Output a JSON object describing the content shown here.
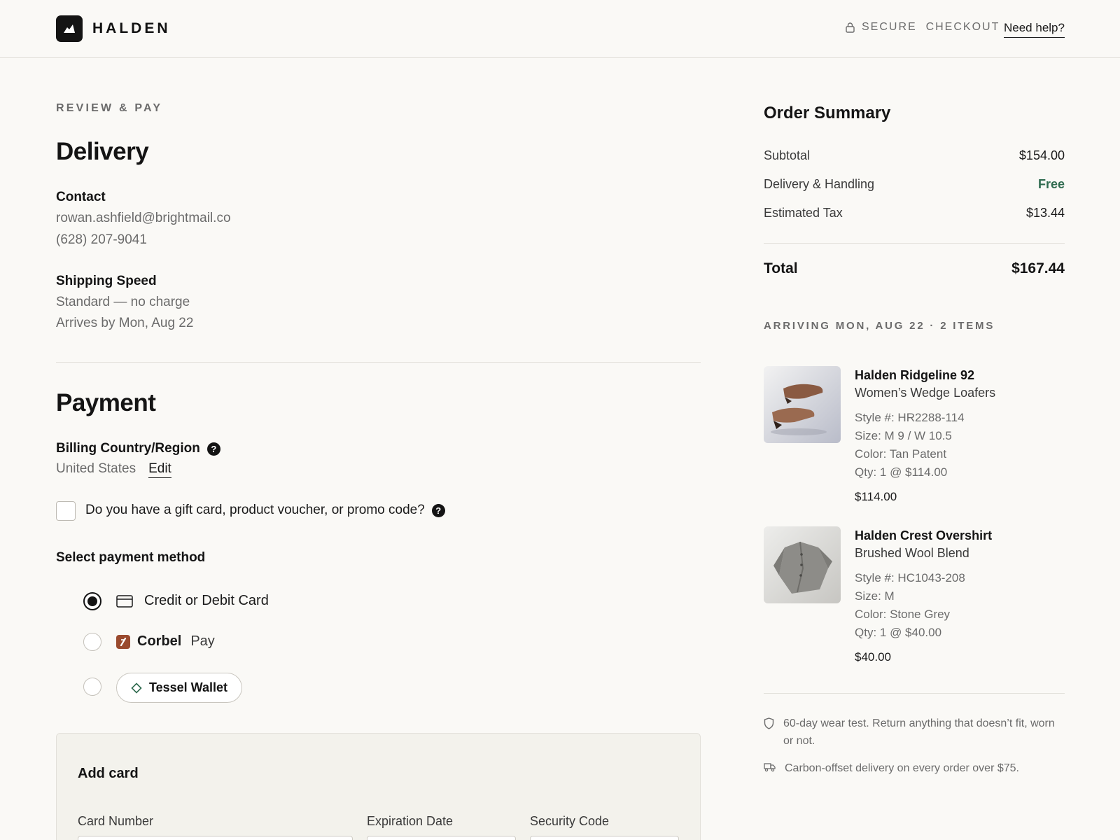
{
  "header": {
    "brand": "HALDEN",
    "secure_label": "SECURE  CHECKOUT",
    "help_link": "Need help?"
  },
  "eyebrow": "REVIEW & PAY",
  "delivery": {
    "heading": "Delivery",
    "contact_label": "Contact",
    "email": "rowan.ashfield@brightmail.co",
    "phone": "(628) 207-9041",
    "shipping_label": "Shipping Speed",
    "shipping_method": "Standard — no charge",
    "arrives": "Arrives by Mon, Aug 22"
  },
  "payment": {
    "heading": "Payment",
    "billing_label": "Billing Country/Region",
    "billing_value": "United States",
    "edit_link": "Edit",
    "promo_question": "Do you have a gift card, product voucher, or promo code?",
    "method_label": "Select payment method",
    "methods": [
      {
        "label": "Credit or Debit Card",
        "selected": true
      },
      {
        "label_bold": "Corbel",
        "label": "Pay",
        "selected": false
      },
      {
        "label": "Tessel Wallet",
        "selected": false
      }
    ],
    "card": {
      "title": "Add card",
      "number_label": "Card Number",
      "expiry_label": "Expiration Date",
      "cvc_label": "Security Code"
    }
  },
  "summary": {
    "title": "Order Summary",
    "subtotal_label": "Subtotal",
    "subtotal": "$154.00",
    "delivery_label": "Delivery & Handling",
    "delivery_value": "Free",
    "tax_label": "Estimated Tax",
    "tax": "$13.44",
    "total_label": "Total",
    "total": "$167.44",
    "arriving": "ARRIVING MON, AUG 22 · 2 ITEMS",
    "items": [
      {
        "name": "Halden Ridgeline 92",
        "subtitle": "Women’s Wedge Loafers",
        "style": "Style #: HR2288-114",
        "size": "Size: M 9 / W 10.5",
        "color": "Color: Tan Patent",
        "qty": "Qty: 1 @ $114.00",
        "price": "$114.00"
      },
      {
        "name": "Halden Crest Overshirt",
        "subtitle": "Brushed Wool Blend",
        "style": "Style #: HC1043-208",
        "size": "Size: M",
        "color": "Color: Stone Grey",
        "qty": "Qty: 1 @ $40.00",
        "price": "$40.00"
      }
    ],
    "notes": [
      {
        "icon": "shield-icon",
        "text": "60-day wear test. Return anything that doesn’t fit, worn or not."
      },
      {
        "icon": "truck-icon",
        "text": "Carbon-offset delivery on every order over $75."
      }
    ]
  },
  "colors": {
    "background": "#faf9f6",
    "ink": "#141414",
    "muted": "#6b6b6b",
    "free_green": "#2f6b4f",
    "corbel_brand": "#9a4a2e"
  }
}
